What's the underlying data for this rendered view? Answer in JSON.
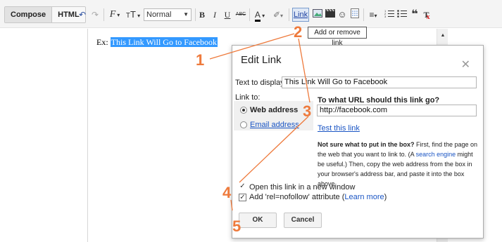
{
  "toolbar": {
    "compose_label": "Compose",
    "html_label": "HTML",
    "font_size_value": "Normal",
    "link_label": "Link",
    "bold_label": "B",
    "italic_label": "I",
    "underline_label": "U",
    "strike_label": "ABC",
    "font_family_label": "F",
    "font_size_label": "T",
    "text_color_label": "A"
  },
  "tooltip": {
    "text": "Add or remove link"
  },
  "editor": {
    "prefix": "Ex:",
    "selected_text": "This Link Will Go to Facebook"
  },
  "dialog": {
    "title": "Edit Link",
    "close_icon": "close-icon",
    "text_to_display_label": "Text to display:",
    "text_to_display_value": "This Link Will Go to Facebook",
    "link_to_label": "Link to:",
    "web_address_label": "Web address",
    "email_address_label": "Email address",
    "url_question": "To what URL should this link go?",
    "url_value": "http://facebook.com",
    "test_link_label": "Test this link",
    "help_bold": "Not sure what to put in the box?",
    "help_part1": " First, find the page on the web that you want to link to. (A ",
    "help_link": "search engine",
    "help_part2": " might be useful.) Then, copy the web address from the box in your browser's address bar, and paste it into the box above.",
    "new_window_label": "Open this link in a new window",
    "nofollow_label": "Add 'rel=nofollow' attribute (",
    "learn_more_label": "Learn more",
    "nofollow_close": ")",
    "ok_label": "OK",
    "cancel_label": "Cancel"
  },
  "annotations": {
    "one": "1",
    "two": "2",
    "three": "3",
    "four": "4",
    "five": "5",
    "color": "#ee7a3c"
  }
}
